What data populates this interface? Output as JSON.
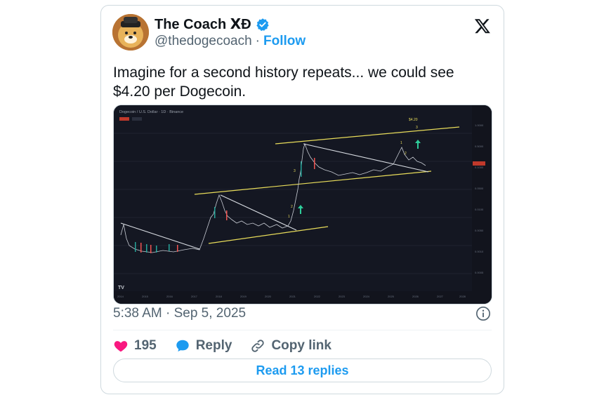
{
  "author": {
    "display_name": "The Coach ⅩĐ",
    "handle": "@thedogecoach",
    "separator": "·",
    "follow_label": "Follow"
  },
  "tweet": {
    "text": "Imagine for a second history repeats... we could see $4.20 per Dogecoin.",
    "timestamp": "5:38 AM · Sep 5, 2025"
  },
  "chart": {
    "header": "Dogecoin / U.S. Dollar · 1D · Binance",
    "target_label": "$4.20",
    "wave_labels": [
      "1",
      "2",
      "3",
      "3",
      "1",
      "2",
      "3"
    ],
    "tv_logo": "TV",
    "x_ticks": [
      "2014",
      "2015",
      "2016",
      "2017",
      "2018",
      "2019",
      "2020",
      "2021",
      "2022",
      "2023",
      "2024",
      "2025",
      "2026",
      "2027",
      "2028"
    ],
    "line_color": "#e8dc5a",
    "trend_color": "#d9dde3"
  },
  "engagement": {
    "likes": "195",
    "reply_label": "Reply",
    "copy_link_label": "Copy link",
    "read_replies_label": "Read 13 replies"
  },
  "colors": {
    "accent": "#1d9bf0",
    "like": "#f91880",
    "chart_bg": "#141722"
  }
}
